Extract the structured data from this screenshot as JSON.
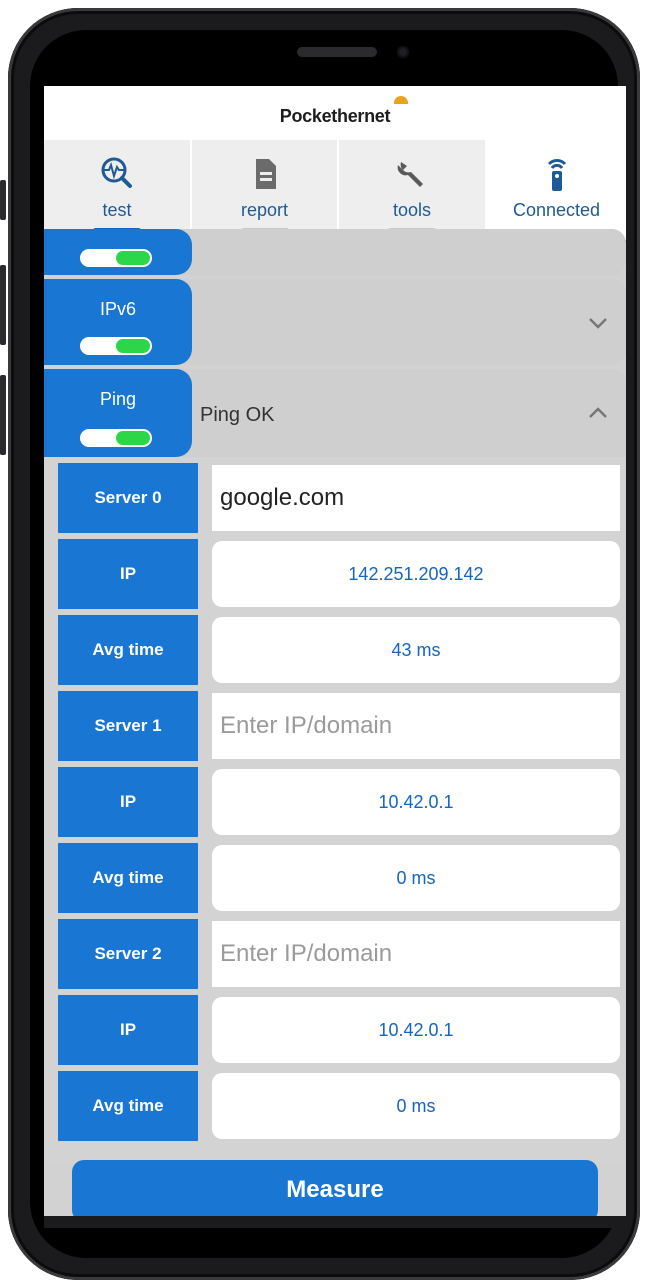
{
  "app": {
    "brand": "Pockethernet"
  },
  "tabs": [
    {
      "label": "test",
      "icon": "pulse-magnifier-icon",
      "active": true
    },
    {
      "label": "report",
      "icon": "document-icon",
      "active": false
    },
    {
      "label": "tools",
      "icon": "wrench-icon",
      "active": false
    },
    {
      "label": "Connected",
      "icon": "bluetooth-device-icon",
      "active": false
    }
  ],
  "sections": {
    "ipv6": {
      "name": "IPv6",
      "enabled": true,
      "status": ""
    },
    "ping": {
      "name": "Ping",
      "enabled": true,
      "status": "Ping OK",
      "expanded": true
    }
  },
  "ping": {
    "server0": {
      "label": "Server 0",
      "value": "google.com",
      "placeholder": "Enter IP/domain"
    },
    "ip0": {
      "label": "IP",
      "value": "142.251.209.142"
    },
    "avg0": {
      "label": "Avg time",
      "value": "43 ms"
    },
    "server1": {
      "label": "Server 1",
      "value": "",
      "placeholder": "Enter IP/domain"
    },
    "ip1": {
      "label": "IP",
      "value": "10.42.0.1"
    },
    "avg1": {
      "label": "Avg time",
      "value": "0 ms"
    },
    "server2": {
      "label": "Server 2",
      "value": "",
      "placeholder": "Enter IP/domain"
    },
    "ip2": {
      "label": "IP",
      "value": "10.42.0.1"
    },
    "avg2": {
      "label": "Avg time",
      "value": "0 ms"
    }
  },
  "actions": {
    "measure_label": "Measure"
  },
  "colors": {
    "accent": "#1976d2",
    "toggle_on": "#2bd648",
    "panel": "#d3d3d3"
  }
}
